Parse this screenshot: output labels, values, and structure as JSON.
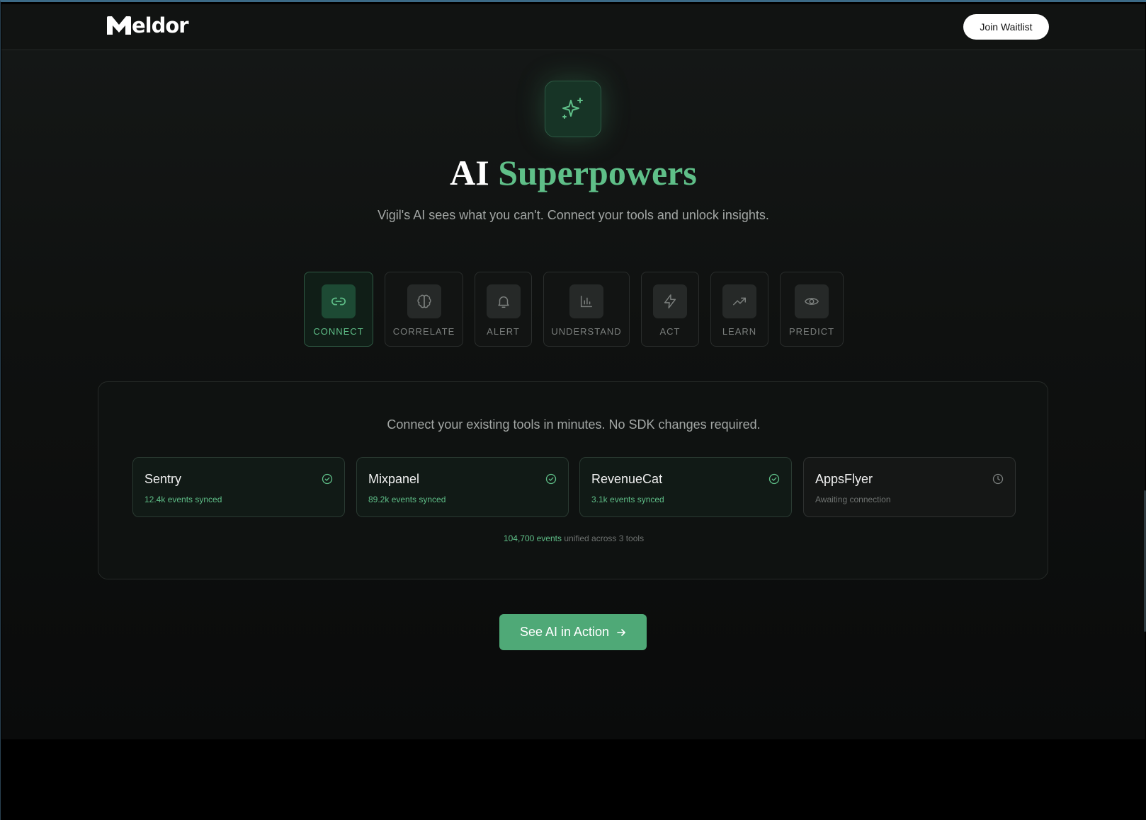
{
  "brand": {
    "name": "eldor",
    "logo_icon": "meldor-m-logo"
  },
  "header": {
    "cta_label": "Join Waitlist"
  },
  "hero": {
    "icon": "sparkles-icon",
    "title_plain": "AI",
    "title_accent": "Superpowers",
    "subtitle": "Vigil's AI sees what you can't. Connect your tools and unlock insights."
  },
  "tabs": [
    {
      "label": "CONNECT",
      "icon": "link-icon",
      "active": true
    },
    {
      "label": "CORRELATE",
      "icon": "brain-icon",
      "active": false
    },
    {
      "label": "ALERT",
      "icon": "bell-icon",
      "active": false
    },
    {
      "label": "UNDERSTAND",
      "icon": "bar-chart-icon",
      "active": false
    },
    {
      "label": "ACT",
      "icon": "lightning-icon",
      "active": false
    },
    {
      "label": "LEARN",
      "icon": "trending-up-icon",
      "active": false
    },
    {
      "label": "PREDICT",
      "icon": "eye-icon",
      "active": false
    }
  ],
  "panel": {
    "description": "Connect your existing tools in minutes. No SDK changes required.",
    "tools": [
      {
        "name": "Sentry",
        "status": "12.4k events synced",
        "state": "connected",
        "icon": "check-circle-icon"
      },
      {
        "name": "Mixpanel",
        "status": "89.2k events synced",
        "state": "connected",
        "icon": "check-circle-icon"
      },
      {
        "name": "RevenueCat",
        "status": "3.1k events synced",
        "state": "connected",
        "icon": "check-circle-icon"
      },
      {
        "name": "AppsFlyer",
        "status": "Awaiting connection",
        "state": "pending",
        "icon": "clock-icon"
      }
    ],
    "summary_count": "104,700 events",
    "summary_rest": "unified across 3 tools"
  },
  "cta": {
    "label": "See AI in Action",
    "icon": "arrow-right-icon"
  },
  "colors": {
    "accent": "#5fbf88",
    "cta_bg": "#4fa977",
    "background": "#0f1110"
  }
}
